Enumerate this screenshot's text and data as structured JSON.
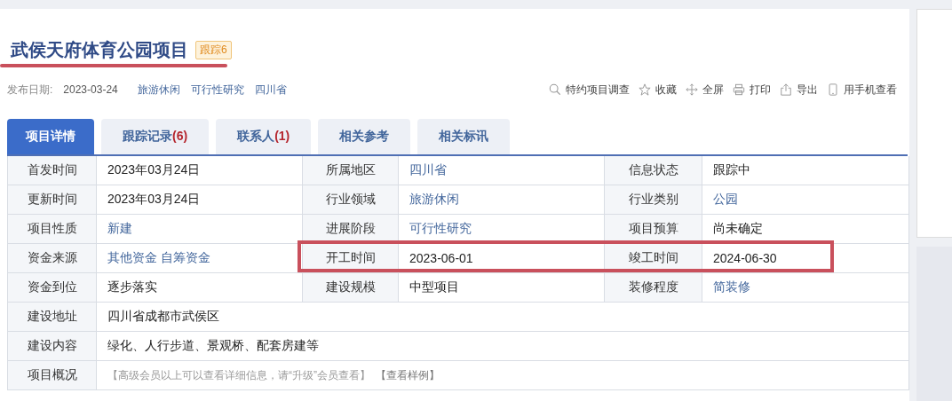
{
  "title": {
    "text": "武侯天府体育公园项目",
    "underlined": true,
    "badge": "跟踪6"
  },
  "meta": {
    "label": "发布日期:",
    "date": "2023-03-24",
    "tags": [
      "旅游休闲",
      "可行性研究",
      "四川省"
    ]
  },
  "actions": [
    "特约项目调查",
    "收藏",
    "全屏",
    "打印",
    "导出",
    "用手机查看"
  ],
  "tabs": [
    {
      "label": "项目详情",
      "selected": true
    },
    {
      "label": "跟踪记录",
      "count": "(6)",
      "selected": false
    },
    {
      "label": "联系人",
      "count": "(1)",
      "selected": false
    },
    {
      "label": "相关参考",
      "selected": false
    },
    {
      "label": "相关标讯",
      "selected": false
    }
  ],
  "rows": [
    {
      "highlighted": false,
      "cells": [
        {
          "label": "首发时间",
          "value": "2023年03月24日",
          "link": false
        },
        {
          "label": "所属地区",
          "value": "四川省",
          "link": true
        },
        {
          "label": "信息状态",
          "value": "跟踪中",
          "link": false
        }
      ]
    },
    {
      "highlighted": false,
      "cells": [
        {
          "label": "更新时间",
          "value": "2023年03月24日",
          "link": false
        },
        {
          "label": "行业领域",
          "value": "旅游休闲",
          "link": true
        },
        {
          "label": "行业类别",
          "value": "公园",
          "link": true
        }
      ]
    },
    {
      "highlighted": false,
      "cells": [
        {
          "label": "项目性质",
          "value": "新建",
          "link": true
        },
        {
          "label": "进展阶段",
          "value": "可行性研究",
          "link": true
        },
        {
          "label": "项目预算",
          "value": "尚未确定",
          "link": false
        }
      ]
    },
    {
      "highlighted": true,
      "cells": [
        {
          "label": "资金来源",
          "value": "其他资金 自筹资金",
          "link": true
        },
        {
          "label": "开工时间",
          "value": "2023-06-01",
          "link": false
        },
        {
          "label": "竣工时间",
          "value": "2024-06-30",
          "link": false
        }
      ]
    },
    {
      "highlighted": false,
      "cells": [
        {
          "label": "资金到位",
          "value": "逐步落实",
          "link": false
        },
        {
          "label": "建设规模",
          "value": "中型项目",
          "link": false
        },
        {
          "label": "装修程度",
          "value": "简装修",
          "link": true
        }
      ]
    },
    {
      "highlighted": false,
      "cells": [
        {
          "label": "建设地址",
          "value": "四川省成都市武侯区",
          "link": false
        }
      ]
    },
    {
      "highlighted": false,
      "cells": [
        {
          "label": "建设内容",
          "value": "绿化、人行步道、景观桥、配套房建等",
          "link": false
        }
      ]
    },
    {
      "highlighted": false,
      "cells": [
        {
          "label": "项目概况",
          "note": "【高级会员以上可以查看详细信息，请“升级”会员查看】",
          "sample_link": "【查看样例】"
        }
      ]
    }
  ]
}
